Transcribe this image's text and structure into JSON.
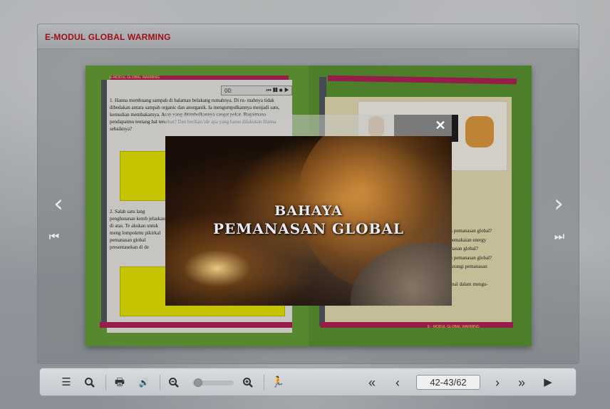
{
  "app": {
    "title": "E-MODUL GLOBAL WARMING"
  },
  "book": {
    "left_page": {
      "header": "E-MODUL GLOBAL WARMING",
      "audio_time": "00:",
      "q1": "1.  Hanna membuang sampah di halaman belakang rumahnya. Di ru- mahnya tidak dibedakan antara sampah organic dan anorganik. Ia mengumpulkannya menjadi satu, kemudian membakarnya. Asap yang ditimbulkannya sangat pekat. Bagaimana pendapatmu tentang hal tersebut? Dan berikan ide apa yang harus dilakukan Hanna sebaiknya?",
      "q2": "2.  Salah satu lang penghutanan kemb jelaskan di atas. Te akukan untuk meng lompokmu pikirkal pemanasan global presentasekan di de"
    },
    "right_page": {
      "lines": [
        "ngi pemanasan global?",
        "n pemakaian energy",
        "nanasan global?",
        "ngi pemanasan global?",
        "ngurangi pemanasan",
        "",
        "sional dalam mengu-"
      ],
      "footer": "E - MODUL GLOBAL WARMING"
    }
  },
  "video": {
    "line1": "BAHAYA",
    "line2": "PEMANASAN GLOBAL"
  },
  "close_label": "✕",
  "toolbar": {
    "page_indicator": "42-43/62",
    "zoom_level": 0.05
  },
  "colors": {
    "title_red": "#c0141a",
    "page_green": "#6ba53a",
    "stripe_magenta": "#b8245a",
    "answer_yellow": "#f1f000"
  }
}
